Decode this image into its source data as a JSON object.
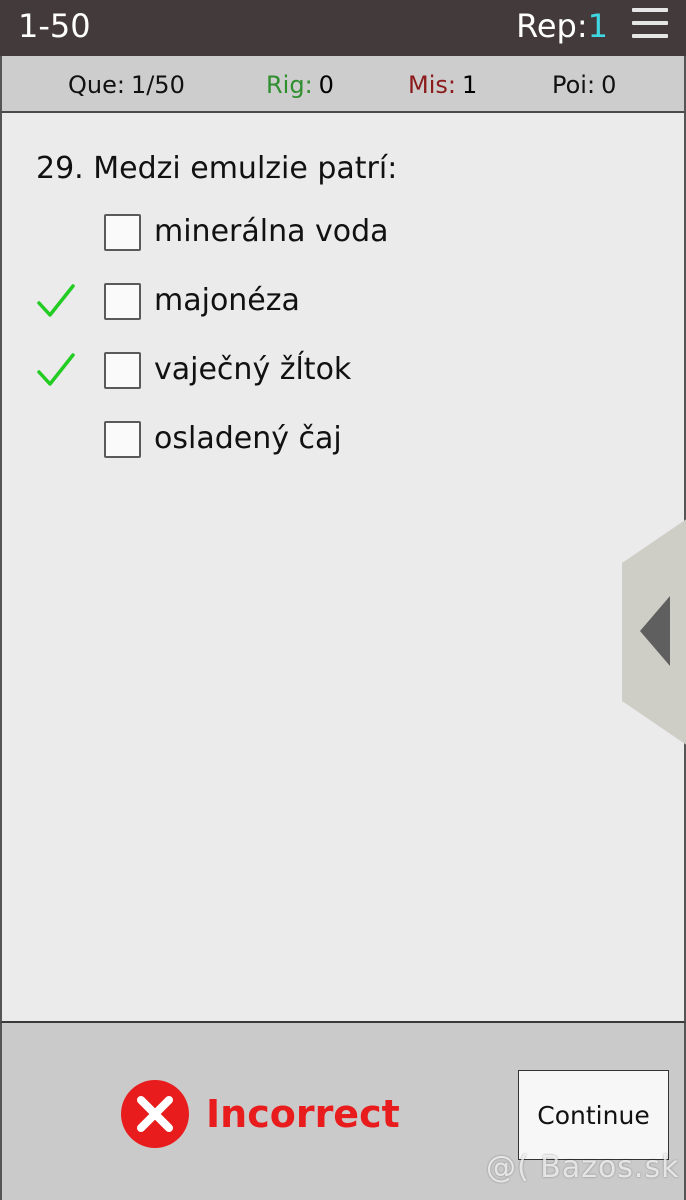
{
  "header": {
    "title": "1-50",
    "rep_label": "Rep:",
    "rep_value": "1",
    "menu_icon": "hamburger-menu-icon"
  },
  "stats": {
    "que_label": "Que:",
    "que_value": "1/50",
    "rig_label": "Rig:",
    "rig_value": "0",
    "mis_label": "Mis:",
    "mis_value": "1",
    "poi_label": "Poi:",
    "poi_value": "0"
  },
  "question": {
    "text": "29. Medzi emulzie patrí:",
    "answers": [
      {
        "label": "minerálna voda",
        "correct": false
      },
      {
        "label": "majonéza",
        "correct": true
      },
      {
        "label": "vaječný žĺtok",
        "correct": true
      },
      {
        "label": "osladený čaj",
        "correct": false
      }
    ]
  },
  "side_tab": {
    "icon": "chevron-left-icon"
  },
  "result": {
    "text": "Incorrect",
    "icon": "error-x-icon"
  },
  "continue_label": "Continue",
  "watermark": "@( Bazos.sk",
  "colors": {
    "topbar": "#433b3b",
    "rep_value": "#3fd7e2",
    "correct_label": "#2f8f2f",
    "mistake_label": "#8b1a1a",
    "incorrect": "#e81c1c",
    "check": "#22cc22"
  }
}
